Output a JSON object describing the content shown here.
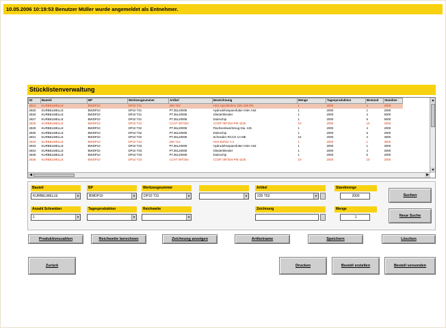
{
  "status_message": "10.05.2006 10:19:53   Benutzer Müller wurde angemeldet als Entnehmer.",
  "title": "Stücklistenverwaltung",
  "columns": [
    "ID",
    "Bauteil",
    "BP",
    "Werkzeugnummer",
    "Artikel",
    "Bezeichnung",
    "Menge",
    "Tagesproduktion",
    "Bestand",
    "Standme"
  ],
  "rows": [
    {
      "c": [
        "2824",
        "KURBELWELLE",
        "BWDP10",
        "DP10 T31",
        "295 T63",
        "HSS Spiralbohrer DIN 338 RN",
        "1",
        "2000",
        "4",
        "2000"
      ],
      "style": "red sel"
    },
    {
      "c": [
        "2825",
        "KURBELWELLE",
        "BWDP10",
        "DP10 T31",
        "PT.35L20009",
        "Hydrodehnspannfutter HSK-A63",
        "1",
        "2000",
        "1",
        "2000"
      ],
      "style": ""
    },
    {
      "c": [
        "2826",
        "KURBELWELLE",
        "BWDP10",
        "DP10 T31",
        "PT.35L20008",
        "Gliederblender",
        "1",
        "2000",
        "4",
        "5000"
      ],
      "style": ""
    },
    {
      "c": [
        "2827",
        "KURBELWELLE",
        "BWDP10",
        "DP10 T31",
        "PT.35L20008",
        "Dulenchip",
        "1",
        "2000",
        "5",
        "5000"
      ],
      "style": ""
    },
    {
      "c": [
        "2828",
        "KURBELWELLE",
        "BWDP10",
        "DP10 T31",
        "CCHT 09T304",
        "CCMT 09T304-PM 4225",
        "10",
        "2000",
        "10",
        "2000"
      ],
      "style": "red"
    },
    {
      "c": [
        "2829",
        "KURBELWELLE",
        "BWDP10",
        "DP10 T32",
        "PT.36L20009",
        "Flachsenkwerkzeug Dia. 125",
        "1",
        "2000",
        "4",
        "2000"
      ],
      "style": ""
    },
    {
      "c": [
        "2830",
        "KURBELWELLE",
        "BWDP10",
        "DP10 T32",
        "PT.36L20008",
        "Dulenchip",
        "1",
        "2000",
        "5",
        "2000"
      ],
      "style": ""
    },
    {
      "c": [
        "2831",
        "KURBELWELLE",
        "BWDP10",
        "DP10 T32",
        "PT.36L20009",
        "Schneider RCCG 1A ME",
        "10",
        "2000",
        "4",
        "3000"
      ],
      "style": ""
    },
    {
      "c": [
        "2832",
        "KURBELWELLE",
        "BWDP10",
        "DP10 T32",
        "256 TL6",
        "HSS Bohrer A 2",
        "1",
        "2000",
        "1",
        "3000"
      ],
      "style": "red"
    },
    {
      "c": [
        "2833",
        "KURBELWELLE",
        "BWDP10",
        "DP10 T33",
        "PT.36L20009",
        "Hydrodehnspannfutter HSK-A63",
        "1",
        "2000",
        "1",
        "2000"
      ],
      "style": ""
    },
    {
      "c": [
        "2834",
        "KURBELWELLE",
        "BWDP10",
        "DP10 T33",
        "PT.36L20008",
        "Gliederblender",
        "1",
        "2000",
        "4",
        "2000"
      ],
      "style": ""
    },
    {
      "c": [
        "2835",
        "KURBELWELLE",
        "BWDP10",
        "DP10 T33",
        "PT.36L20008",
        "Dulenchip",
        "1",
        "2000",
        "5",
        "2000"
      ],
      "style": ""
    },
    {
      "c": [
        "2836",
        "KURBELWELLE",
        "BWDP10",
        "DP10 T33",
        "CCHT 09T304",
        "CCMT 09T304-PM 4225",
        "10",
        "2000",
        "10",
        "2000"
      ],
      "style": "red"
    }
  ],
  "form": {
    "bauteil": {
      "label": "Bauteil",
      "value": "KURBELWELLE"
    },
    "bp": {
      "label": "BP",
      "value": "BWDP10"
    },
    "werkzeugnummer": {
      "label": "Werkzeugnummer",
      "value": "DP10 T31"
    },
    "blank": {
      "label": "",
      "value": ""
    },
    "artikel": {
      "label": "Artikel",
      "value": "235 T63"
    },
    "standmenge": {
      "label": "Standmenge",
      "value": "2000"
    },
    "anzahl_schneiden": {
      "label": "Anzahl Schneiden",
      "value": "1"
    },
    "tagesproduktion": {
      "label": "Tagesproduktion",
      "value": ""
    },
    "reichweite": {
      "label": "Reichweite",
      "value": ""
    },
    "zeichnung": {
      "label": "Zeichnung",
      "value": ""
    },
    "menge": {
      "label": "Menge",
      "value": "1"
    }
  },
  "buttons": {
    "suchen": "Suchen",
    "neue_suche": "Neue Suche",
    "produktionszahlen": "Produktionszahlen",
    "reichweite_berechnen": "Reichweite berechnen",
    "zeichnung_anzeigen": "Zeichnung anzeigen",
    "artikelname": "Artikelname",
    "speichern": "Speichern",
    "loeschen": "Löschen",
    "zurueck": "Zurück",
    "drucken": "Drucken",
    "bestell_erstellen": "Bestell erstellen",
    "bestell_versenden": "Bestell versenden"
  }
}
